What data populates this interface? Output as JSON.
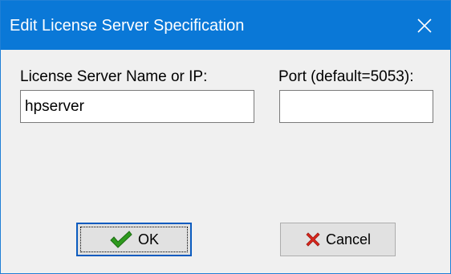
{
  "window": {
    "title": "Edit License Server Specification"
  },
  "form": {
    "name_label": "License Server Name or IP:",
    "name_value": "hpserver",
    "port_label": "Port (default=5053):",
    "port_value": ""
  },
  "buttons": {
    "ok_label": "OK",
    "ok_icon": "checkmark-icon",
    "cancel_label": "Cancel",
    "cancel_icon": "red-x-icon"
  },
  "colors": {
    "titlebar": "#0a78d7",
    "checkmark": "#2e9a1e",
    "cancel_x": "#d9261c"
  }
}
